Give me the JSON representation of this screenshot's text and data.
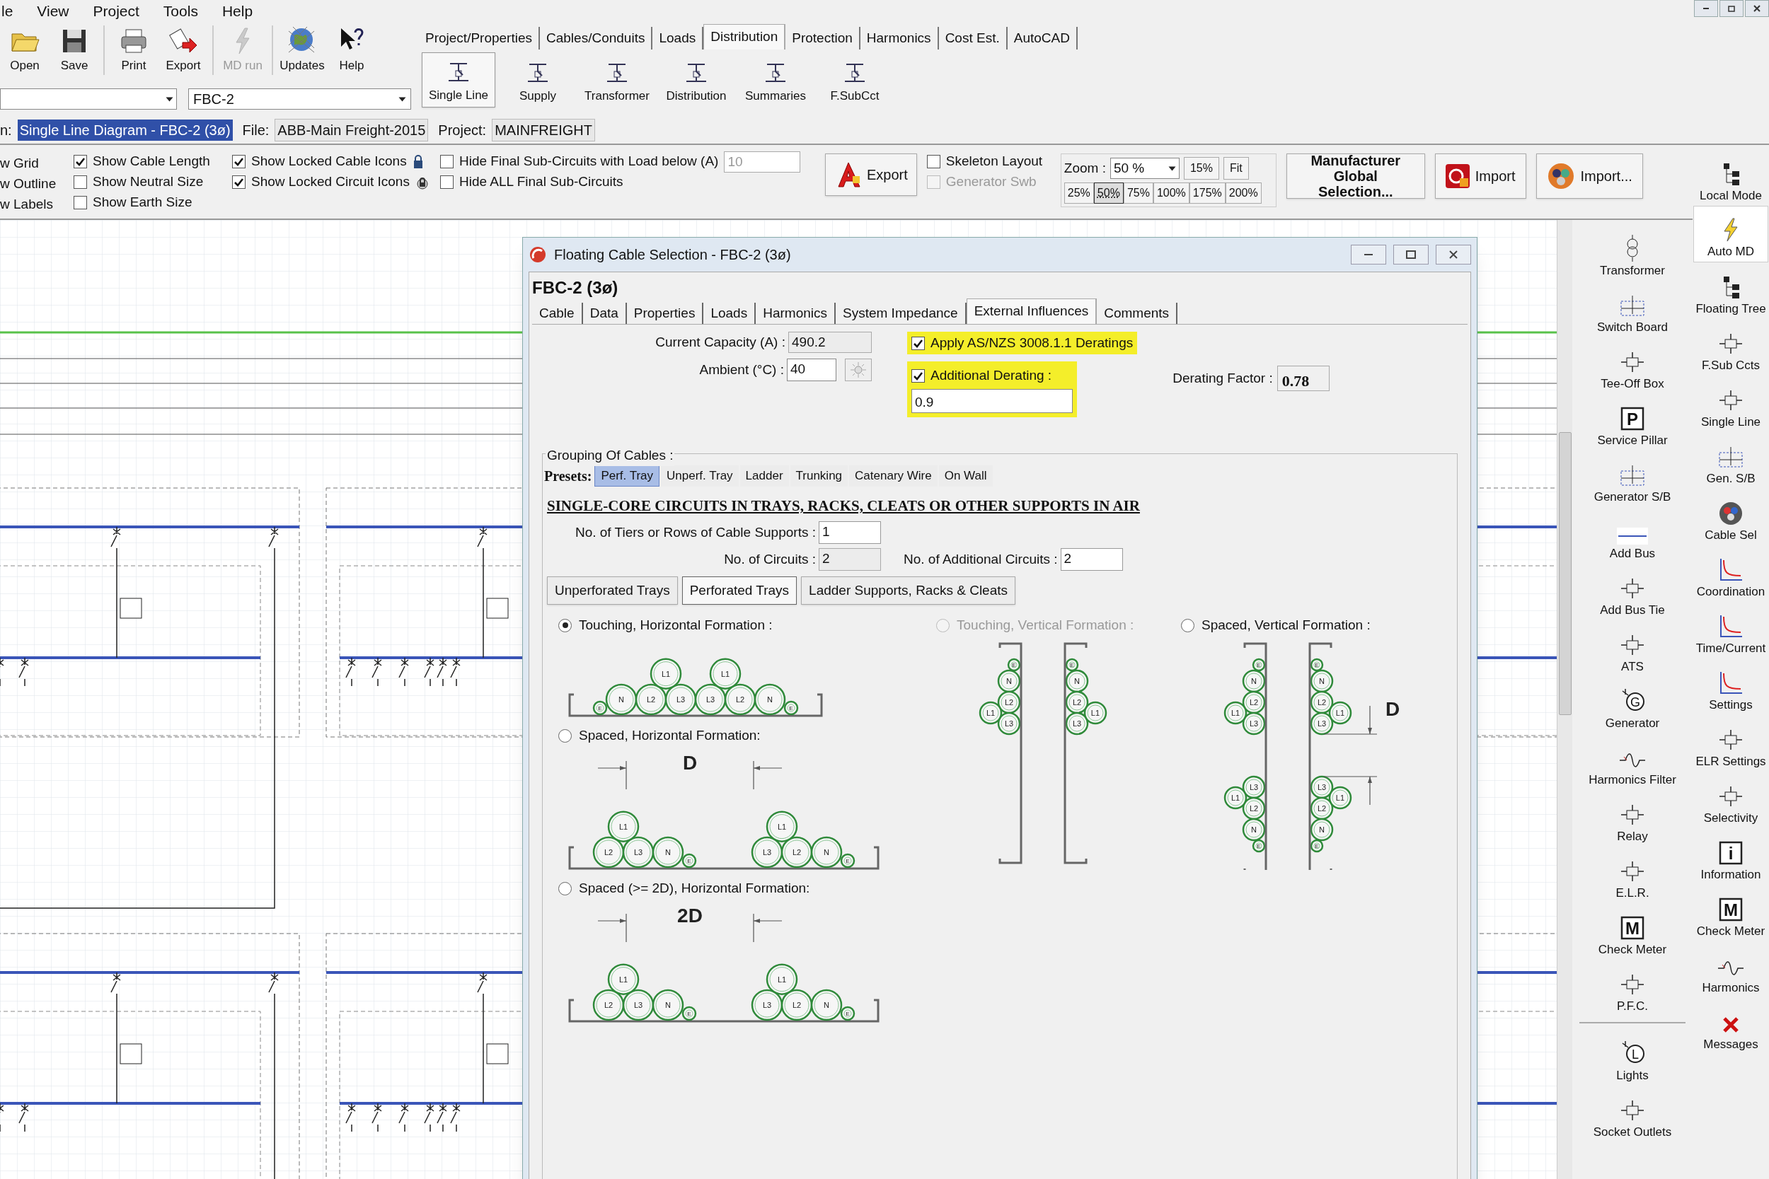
{
  "menu": [
    "le",
    "View",
    "Project",
    "Tools",
    "Help"
  ],
  "toolbar": [
    {
      "label": "Open",
      "disabled": false
    },
    {
      "label": "Save",
      "disabled": false
    },
    {
      "label": "Print",
      "disabled": false
    },
    {
      "label": "Export",
      "disabled": false
    },
    {
      "label": "MD run",
      "disabled": true
    },
    {
      "label": "Updates",
      "disabled": false
    },
    {
      "label": "Help",
      "disabled": false
    }
  ],
  "ribbon_tabs": [
    {
      "label": "Project/Properties",
      "selected": false
    },
    {
      "label": "Cables/Conduits",
      "selected": false
    },
    {
      "label": "Loads",
      "selected": false
    },
    {
      "label": "Distribution",
      "selected": true
    },
    {
      "label": "Protection",
      "selected": false
    },
    {
      "label": "Harmonics",
      "selected": false
    },
    {
      "label": "Cost Est.",
      "selected": false
    },
    {
      "label": "AutoCAD",
      "selected": false
    }
  ],
  "ribbon_buttons": [
    {
      "label": "Single Line",
      "selected": true
    },
    {
      "label": "Supply",
      "selected": false
    },
    {
      "label": "Transformer",
      "selected": false
    },
    {
      "label": "Distribution",
      "selected": false
    },
    {
      "label": "Summaries",
      "selected": false
    },
    {
      "label": "F.SubCct",
      "selected": false
    }
  ],
  "diagram_select": {
    "value": "FBC-2"
  },
  "info": {
    "view_label": "n:",
    "view": "Single Line Diagram - FBC-2 (3ø)",
    "file_label": "File:",
    "file": "ABB-Main Freight-2015",
    "project_label": "Project:",
    "project": "MAINFREIGHT"
  },
  "view_options_cut": [
    "w Grid",
    "w Outline",
    "w Labels"
  ],
  "view_options": [
    {
      "label": "Show Cable Length",
      "checked": true
    },
    {
      "label": "Show Neutral Size",
      "checked": false
    },
    {
      "label": "Show Earth Size",
      "checked": false
    }
  ],
  "lock_options": [
    {
      "label": "Show Locked Cable Icons",
      "checked": true
    },
    {
      "label": "Show Locked Circuit Icons",
      "checked": true
    }
  ],
  "hide_options": [
    {
      "label": "Hide Final Sub-Circuits with Load below (A)",
      "checked": false,
      "value": "10"
    },
    {
      "label": "Hide ALL Final Sub-Circuits",
      "checked": false
    }
  ],
  "export_button": "Export",
  "layout_options": [
    {
      "label": "Skeleton Layout",
      "checked": false,
      "disabled": false
    },
    {
      "label": "Generator Swb",
      "checked": false,
      "disabled": true
    }
  ],
  "zoom": {
    "label": "Zoom :",
    "value": "50 %",
    "buttons": [
      {
        "label": "15%",
        "selected": false
      },
      {
        "label": "Fit",
        "selected": false
      }
    ],
    "presets": [
      {
        "label": "25%",
        "selected": false
      },
      {
        "label": "50%",
        "selected": true
      },
      {
        "label": "75%",
        "selected": false
      },
      {
        "label": "100%",
        "selected": false
      },
      {
        "label": "175%",
        "selected": false
      },
      {
        "label": "200%",
        "selected": false
      }
    ]
  },
  "action_buttons": [
    {
      "label": "Manufacturer Global Selection...",
      "kind": "text"
    },
    {
      "label": "Import",
      "kind": "logo"
    },
    {
      "label": "Import...",
      "kind": "cable"
    }
  ],
  "palette_main": [
    {
      "label": "Transformer",
      "kind": "transformer"
    },
    {
      "label": "Switch Board",
      "kind": "board"
    },
    {
      "label": "Tee-Off Box",
      "kind": "symbol"
    },
    {
      "label": "Service Pillar",
      "kind": "glyph-box",
      "glyph": "P"
    },
    {
      "label": "Generator S/B",
      "kind": "board"
    },
    {
      "label": "Add Bus",
      "kind": "bus"
    },
    {
      "label": "Add Bus Tie",
      "kind": "symbol"
    },
    {
      "label": "ATS",
      "kind": "symbol"
    },
    {
      "label": "Generator",
      "kind": "glyph-circle",
      "glyph": "G"
    },
    {
      "label": "Harmonics Filter",
      "kind": "wave"
    },
    {
      "label": "Relay",
      "kind": "symbol"
    },
    {
      "label": "E.L.R.",
      "kind": "symbol"
    },
    {
      "label": "Check Meter",
      "kind": "glyph-box",
      "glyph": "M"
    },
    {
      "label": "P.F.C.",
      "kind": "symbol"
    }
  ],
  "palette_loads": [
    {
      "label": "Lights",
      "kind": "glyph-circle",
      "glyph": "L"
    },
    {
      "label": "Socket Outlets",
      "kind": "symbol"
    }
  ],
  "tools": [
    {
      "label": "Local Mode",
      "kind": "tree",
      "selected": false
    },
    {
      "label": "Auto MD",
      "kind": "bolt",
      "selected": true
    },
    {
      "label": "Floating Tree",
      "kind": "tree",
      "selected": false
    },
    {
      "label": "F.Sub Ccts",
      "kind": "symbol",
      "selected": false
    },
    {
      "label": "Single Line",
      "kind": "symbol",
      "selected": false
    },
    {
      "label": "Gen. S/B",
      "kind": "board",
      "selected": false
    },
    {
      "label": "Cable Sel",
      "kind": "cable",
      "selected": false
    },
    {
      "label": "Coordination",
      "kind": "curve",
      "selected": false
    },
    {
      "label": "Time/Current",
      "kind": "curve",
      "selected": false
    },
    {
      "label": "Settings",
      "kind": "curve",
      "selected": false
    },
    {
      "label": "ELR Settings",
      "kind": "symbol",
      "selected": false
    },
    {
      "label": "Selectivity",
      "kind": "symbol",
      "selected": false
    },
    {
      "label": "Information",
      "kind": "glyph-box",
      "glyph": "i",
      "selected": false
    },
    {
      "label": "Check Meter",
      "kind": "glyph-box",
      "glyph": "M",
      "selected": false
    },
    {
      "label": "Harmonics",
      "kind": "wave",
      "selected": false
    },
    {
      "label": "Messages",
      "kind": "cross",
      "selected": false
    }
  ],
  "dialog": {
    "title": "Floating Cable Selection - FBC-2 (3ø)",
    "heading": "FBC-2 (3ø)",
    "tabs": [
      {
        "label": "Cable",
        "selected": false
      },
      {
        "label": "Data",
        "selected": false
      },
      {
        "label": "Properties",
        "selected": false
      },
      {
        "label": "Loads",
        "selected": false
      },
      {
        "label": "Harmonics",
        "selected": false
      },
      {
        "label": "System Impedance",
        "selected": false
      },
      {
        "label": "External Influences",
        "selected": true
      },
      {
        "label": "Comments",
        "selected": false
      }
    ],
    "current_capacity": {
      "label": "Current Capacity (A) :",
      "value": "490.2"
    },
    "ambient": {
      "label": "Ambient (°C) :",
      "value": "40"
    },
    "apply_deratings": {
      "label": "Apply AS/NZS 3008.1.1 Deratings",
      "checked": true
    },
    "additional_derating": {
      "label": "Additional Derating :",
      "checked": true,
      "value": "0.9"
    },
    "derating_factor": {
      "label": "Derating Factor :",
      "value": "0.78"
    },
    "grouping": {
      "legend": "Grouping Of Cables :",
      "presets_label": "Presets:",
      "presets": [
        {
          "label": "Perf. Tray",
          "selected": true
        },
        {
          "label": "Unperf. Tray",
          "selected": false
        },
        {
          "label": "Ladder",
          "selected": false
        },
        {
          "label": "Trunking",
          "selected": false
        },
        {
          "label": "Catenary Wire",
          "selected": false
        },
        {
          "label": "On Wall",
          "selected": false
        }
      ],
      "heading": "SINGLE-CORE CIRCUITS IN TRAYS, RACKS, CLEATS OR OTHER SUPPORTS IN AIR",
      "tiers": {
        "label": "No. of Tiers or Rows of Cable Supports :",
        "value": "1"
      },
      "circuits": {
        "label": "No. of Circuits :",
        "value": "2"
      },
      "additional_circuits": {
        "label": "No. of Additional Circuits :",
        "value": "2"
      },
      "support_types": [
        {
          "label": "Unperforated Trays",
          "selected": false
        },
        {
          "label": "Perforated Trays",
          "selected": true
        },
        {
          "label": "Ladder Supports, Racks & Cleats",
          "selected": false
        }
      ],
      "formations": [
        {
          "label": "Touching, Horizontal Formation :",
          "selected": true,
          "disabled": false,
          "kind": "tray",
          "groups": [
            {
              "earth_before": "E",
              "before": [
                "N",
                "L2"
              ],
              "apex": "L1",
              "after": [
                "L3"
              ]
            },
            {
              "before": [
                "L3"
              ],
              "apex": "L1",
              "after": [
                "L2",
                "N"
              ],
              "earth_after": "E"
            }
          ]
        },
        {
          "label": "Spaced, Horizontal Formation:",
          "selected": false,
          "disabled": false,
          "kind": "tray",
          "spacing": "D",
          "groups": [
            {
              "before": [
                "L2"
              ],
              "apex": "L1",
              "after": [
                "L3",
                "N"
              ],
              "earth_after": "E"
            },
            {
              "before": [
                "L3"
              ],
              "apex": "L1",
              "after": [
                "L2",
                "N"
              ],
              "earth_after": "E"
            }
          ]
        },
        {
          "label": "Spaced (>= 2D), Horizontal Formation:",
          "selected": false,
          "disabled": false,
          "kind": "tray",
          "spacing": "2D",
          "groups": [
            {
              "before": [
                "L2"
              ],
              "apex": "L1",
              "after": [
                "L3",
                "N"
              ],
              "earth_after": "E"
            },
            {
              "before": [
                "L3"
              ],
              "apex": "L1",
              "after": [
                "L2",
                "N"
              ],
              "earth_after": "E"
            }
          ]
        },
        {
          "label": "Touching, Vertical Formation :",
          "selected": false,
          "disabled": true,
          "kind": "rack",
          "racks": [
            {
              "groups": [
                {
                  "earth_before": "E",
                  "before": [
                    "N",
                    "L2"
                  ],
                  "apex": "L1",
                  "after": [
                    "L3"
                  ]
                }
              ]
            },
            {
              "groups": [
                {
                  "earth_before": "E",
                  "before": [
                    "N",
                    "L2"
                  ],
                  "apex": "L1",
                  "after": [
                    "L3"
                  ]
                }
              ]
            }
          ]
        },
        {
          "label": "Spaced, Vertical Formation :",
          "selected": false,
          "disabled": false,
          "kind": "rack",
          "spacing": "D",
          "racks": [
            {
              "groups": [
                {
                  "earth_before": "E",
                  "before": [
                    "N",
                    "L2"
                  ],
                  "apex": "L1",
                  "after": [
                    "L3"
                  ]
                },
                {
                  "before": [
                    "L3"
                  ],
                  "apex": "L1",
                  "after": [
                    "L2",
                    "N"
                  ],
                  "earth_after": "E"
                }
              ]
            },
            {
              "groups": [
                {
                  "earth_before": "E",
                  "before": [
                    "N",
                    "L2"
                  ],
                  "apex": "L1",
                  "after": [
                    "L3"
                  ]
                },
                {
                  "before": [
                    "L3"
                  ],
                  "apex": "L1",
                  "after": [
                    "L2",
                    "N"
                  ],
                  "earth_after": "E"
                }
              ]
            }
          ]
        }
      ]
    }
  }
}
